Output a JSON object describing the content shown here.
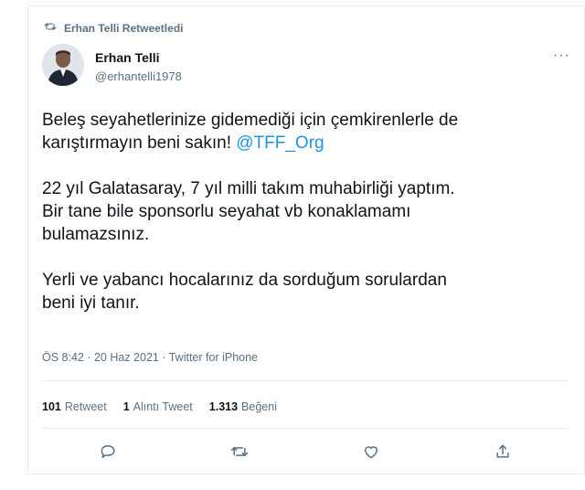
{
  "retweet_context": {
    "icon": "retweet-icon",
    "text": "Erhan Telli Retweetledi"
  },
  "author": {
    "display_name": "Erhan Telli",
    "handle": "@erhantelli1978",
    "avatar_icon": "user-avatar"
  },
  "more_icon": "more-icon",
  "more_text": "···",
  "tweet": {
    "line1_before_mention": "Beleş seyahetlerinize gidemediği için çemkirenlerle de",
    "line2_before_mention": "karıştırmayın beni sakın! ",
    "mention": "@TFF_Org",
    "para2_line1": "22 yıl Galatasaray, 7 yıl milli takım muhabirliği yaptım.",
    "para2_line2": "Bir tane bile sponsorlu seyahat vb konaklamamı",
    "para2_line3": "bulamazsınız.",
    "para3_line1": "Yerli ve yabancı hocalarınız da sorduğum sorulardan",
    "para3_line2": "beni iyi tanır."
  },
  "meta": {
    "text": "ÖS 8:42 · 20 Haz 2021 · Twitter for iPhone"
  },
  "stats": {
    "retweets_count": "101",
    "retweets_label": "Retweet",
    "quotes_count": "1",
    "quotes_label": "Alıntı Tweet",
    "likes_count": "1.313",
    "likes_label": "Beğeni"
  },
  "actions": {
    "reply_icon": "reply-icon",
    "retweet_icon": "retweet-icon",
    "like_icon": "like-icon",
    "share_icon": "share-icon"
  }
}
